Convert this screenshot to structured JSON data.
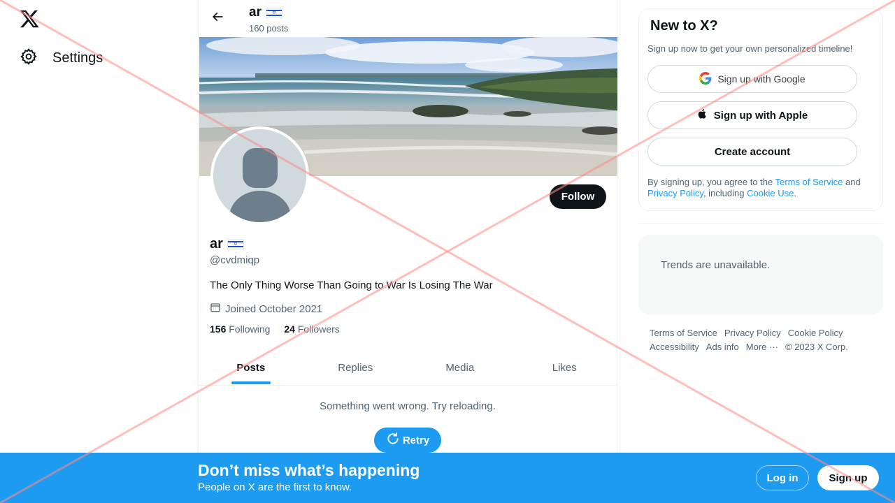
{
  "nav": {
    "settings_label": "Settings"
  },
  "header": {
    "name": "ar",
    "posts_count": "160 posts"
  },
  "profile": {
    "name": "ar",
    "handle": "@cvdmiqp",
    "bio": "The Only Thing Worse Than Going to War Is Losing The War",
    "joined": "Joined October 2021",
    "following_count": "156",
    "following_label": "Following",
    "followers_count": "24",
    "followers_label": "Followers",
    "follow_label": "Follow"
  },
  "tabs": [
    {
      "label": "Posts",
      "active": true
    },
    {
      "label": "Replies",
      "active": false
    },
    {
      "label": "Media",
      "active": false
    },
    {
      "label": "Likes",
      "active": false
    }
  ],
  "feed": {
    "error_message": "Something went wrong. Try reloading.",
    "retry_label": "Retry"
  },
  "signup_card": {
    "title": "New to X?",
    "subtitle": "Sign up now to get your own personalized timeline!",
    "google_label": "Sign up with Google",
    "apple_label": "Sign up with Apple",
    "create_label": "Create account",
    "legal_prefix": "By signing up, you agree to the ",
    "terms_link": "Terms of Service",
    "legal_and": " and ",
    "privacy_link": "Privacy Policy",
    "legal_including": ", including ",
    "cookie_link": "Cookie Use",
    "legal_end": "."
  },
  "trends": {
    "message": "Trends are unavailable."
  },
  "footer": {
    "terms": "Terms of Service",
    "privacy": "Privacy Policy",
    "cookie": "Cookie Policy",
    "accessibility": "Accessibility",
    "ads": "Ads info",
    "more": "More ···",
    "copyright": "© 2023 X Corp."
  },
  "bottom_bar": {
    "title": "Don’t miss what’s happening",
    "subtitle": "People on X are the first to know.",
    "login_label": "Log in",
    "signup_label": "Sign up"
  },
  "colors": {
    "accent": "#1d9bf0",
    "text": "#0f1419",
    "muted": "#536471",
    "overlay": "#ff9a9a"
  }
}
